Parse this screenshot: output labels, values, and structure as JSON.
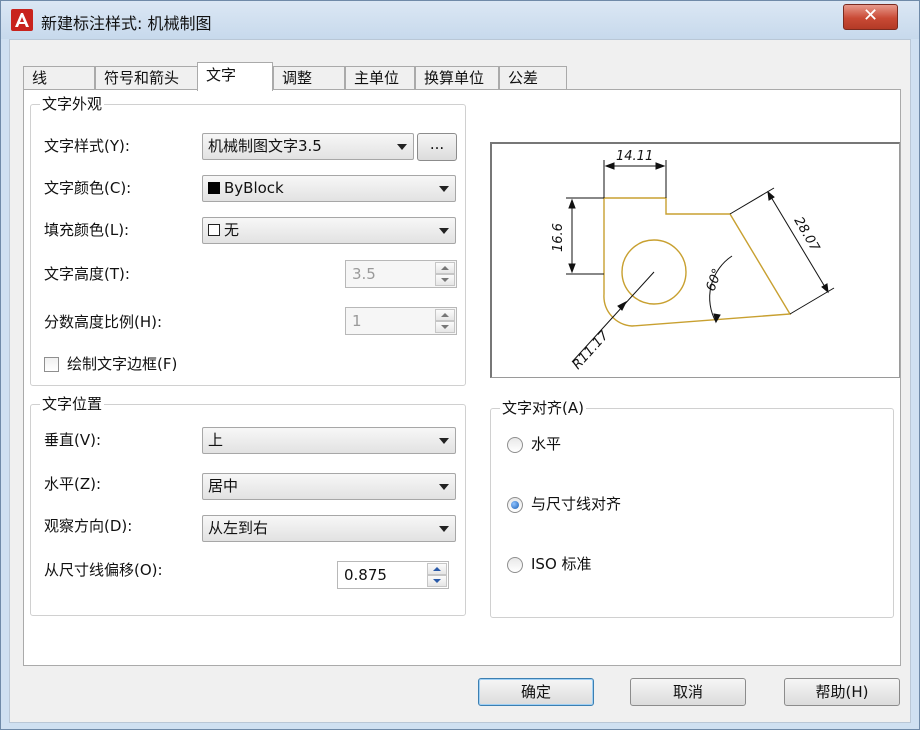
{
  "window": {
    "title": "新建标注样式: 机械制图",
    "close_glyph": "✕"
  },
  "tabs": [
    {
      "label": "线"
    },
    {
      "label": "符号和箭头"
    },
    {
      "label": "文字"
    },
    {
      "label": "调整"
    },
    {
      "label": "主单位"
    },
    {
      "label": "换算单位"
    },
    {
      "label": "公差"
    }
  ],
  "appearance": {
    "legend": "文字外观",
    "style_label": "文字样式(Y):",
    "style_value": "机械制图文字3.5",
    "style_browse": "...",
    "color_label": "文字颜色(C):",
    "color_value": "ByBlock",
    "fill_label": "填充颜色(L):",
    "fill_value": "无",
    "height_label": "文字高度(T):",
    "height_value": "3.5",
    "fraction_label": "分数高度比例(H):",
    "fraction_value": "1",
    "frame_label": "绘制文字边框(F)"
  },
  "placement": {
    "legend": "文字位置",
    "vertical_label": "垂直(V):",
    "vertical_value": "上",
    "horizontal_label": "水平(Z):",
    "horizontal_value": "居中",
    "view_label": "观察方向(D):",
    "view_value": "从左到右",
    "offset_label": "从尺寸线偏移(O):",
    "offset_value": "0.875"
  },
  "alignment": {
    "legend": "文字对齐(A)",
    "opt1": "水平",
    "opt2": "与尺寸线对齐",
    "opt3": "ISO 标准",
    "selected": "与尺寸线对齐"
  },
  "preview": {
    "dim_top": "14.11",
    "dim_left": "16.6",
    "dim_right": "28.07",
    "dim_angle": "60°",
    "dim_radius": "R11.17"
  },
  "buttons": {
    "ok": "确定",
    "cancel": "取消",
    "help": "帮助(H)"
  },
  "colors": {
    "accent": "#c8231d",
    "geometry": "#c8a030",
    "close": "#c94a35"
  }
}
